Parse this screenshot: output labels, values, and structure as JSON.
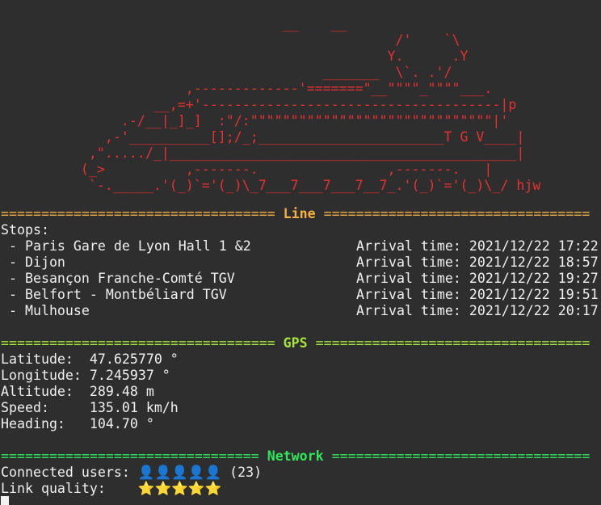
{
  "colors": {
    "background": "#2e2e2e",
    "text": "#f0f0f0",
    "train": "#e83030",
    "line_section": "#f5b041",
    "gps_section": "#a5e53a",
    "network_section": "#2ee65b"
  },
  "train_ascii": "                                   __    __\n                                                 /'    `\\\n                                                Y.      .Y\n                                        _______  \\`. .'/\n                       ,-------------'=======\"__\"\"\"\"_\"\"\"\"___.\n                   __,=+'-------------------------------------|p\n               .-/__|_]_]  :\"/:\"\"\"\"\"\"\"\"\"\"\"\"\"\"\"\"\"\"\"\"\"\"\"\"\"\"\"\"\"\"|'\n             ,-'__________[];/_;_______________________T G V____|\n           ,\"...../_|___________________________________________|\n          (_>          ,-------.                ,-------.   |\n           `-._____.'(_)`='(_)\\_7___7___7___7__7_.'(_)`='(_)\\_/ hjw",
  "line": {
    "separator_left": "==================================",
    "title": "Line",
    "separator_right": "=================================",
    "stops_label": "Stops:",
    "stops": [
      {
        "name": " - Paris Gare de Lyon Hall 1 &2",
        "arrival": "Arrival time: 2021/12/22 17:22"
      },
      {
        "name": " - Dijon",
        "arrival": "Arrival time: 2021/12/22 18:57"
      },
      {
        "name": " - Besançon Franche-Comté TGV",
        "arrival": "Arrival time: 2021/12/22 19:27"
      },
      {
        "name": " - Belfort - Montbéliard TGV",
        "arrival": "Arrival time: 2021/12/22 19:51"
      },
      {
        "name": " - Mulhouse",
        "arrival": "Arrival time: 2021/12/22 20:17"
      }
    ]
  },
  "gps": {
    "separator_left": "==================================",
    "title": "GPS",
    "separator_right": "==================================",
    "latitude": "Latitude:  47.625770 °",
    "longitude": "Longitude: 7.245937 °",
    "altitude": "Altitude:  289.48 m",
    "speed": "Speed:     135.01 km/h",
    "heading": "Heading:   104.70 °"
  },
  "network": {
    "separator_left": "================================",
    "title": "Network",
    "separator_right": "================================",
    "users_label": "Connected users: ",
    "users_icons": "👤👤👤👤👤",
    "users_count": " (23)",
    "quality_label": "Link quality:    ",
    "quality_icons": "⭐⭐⭐⭐⭐"
  }
}
